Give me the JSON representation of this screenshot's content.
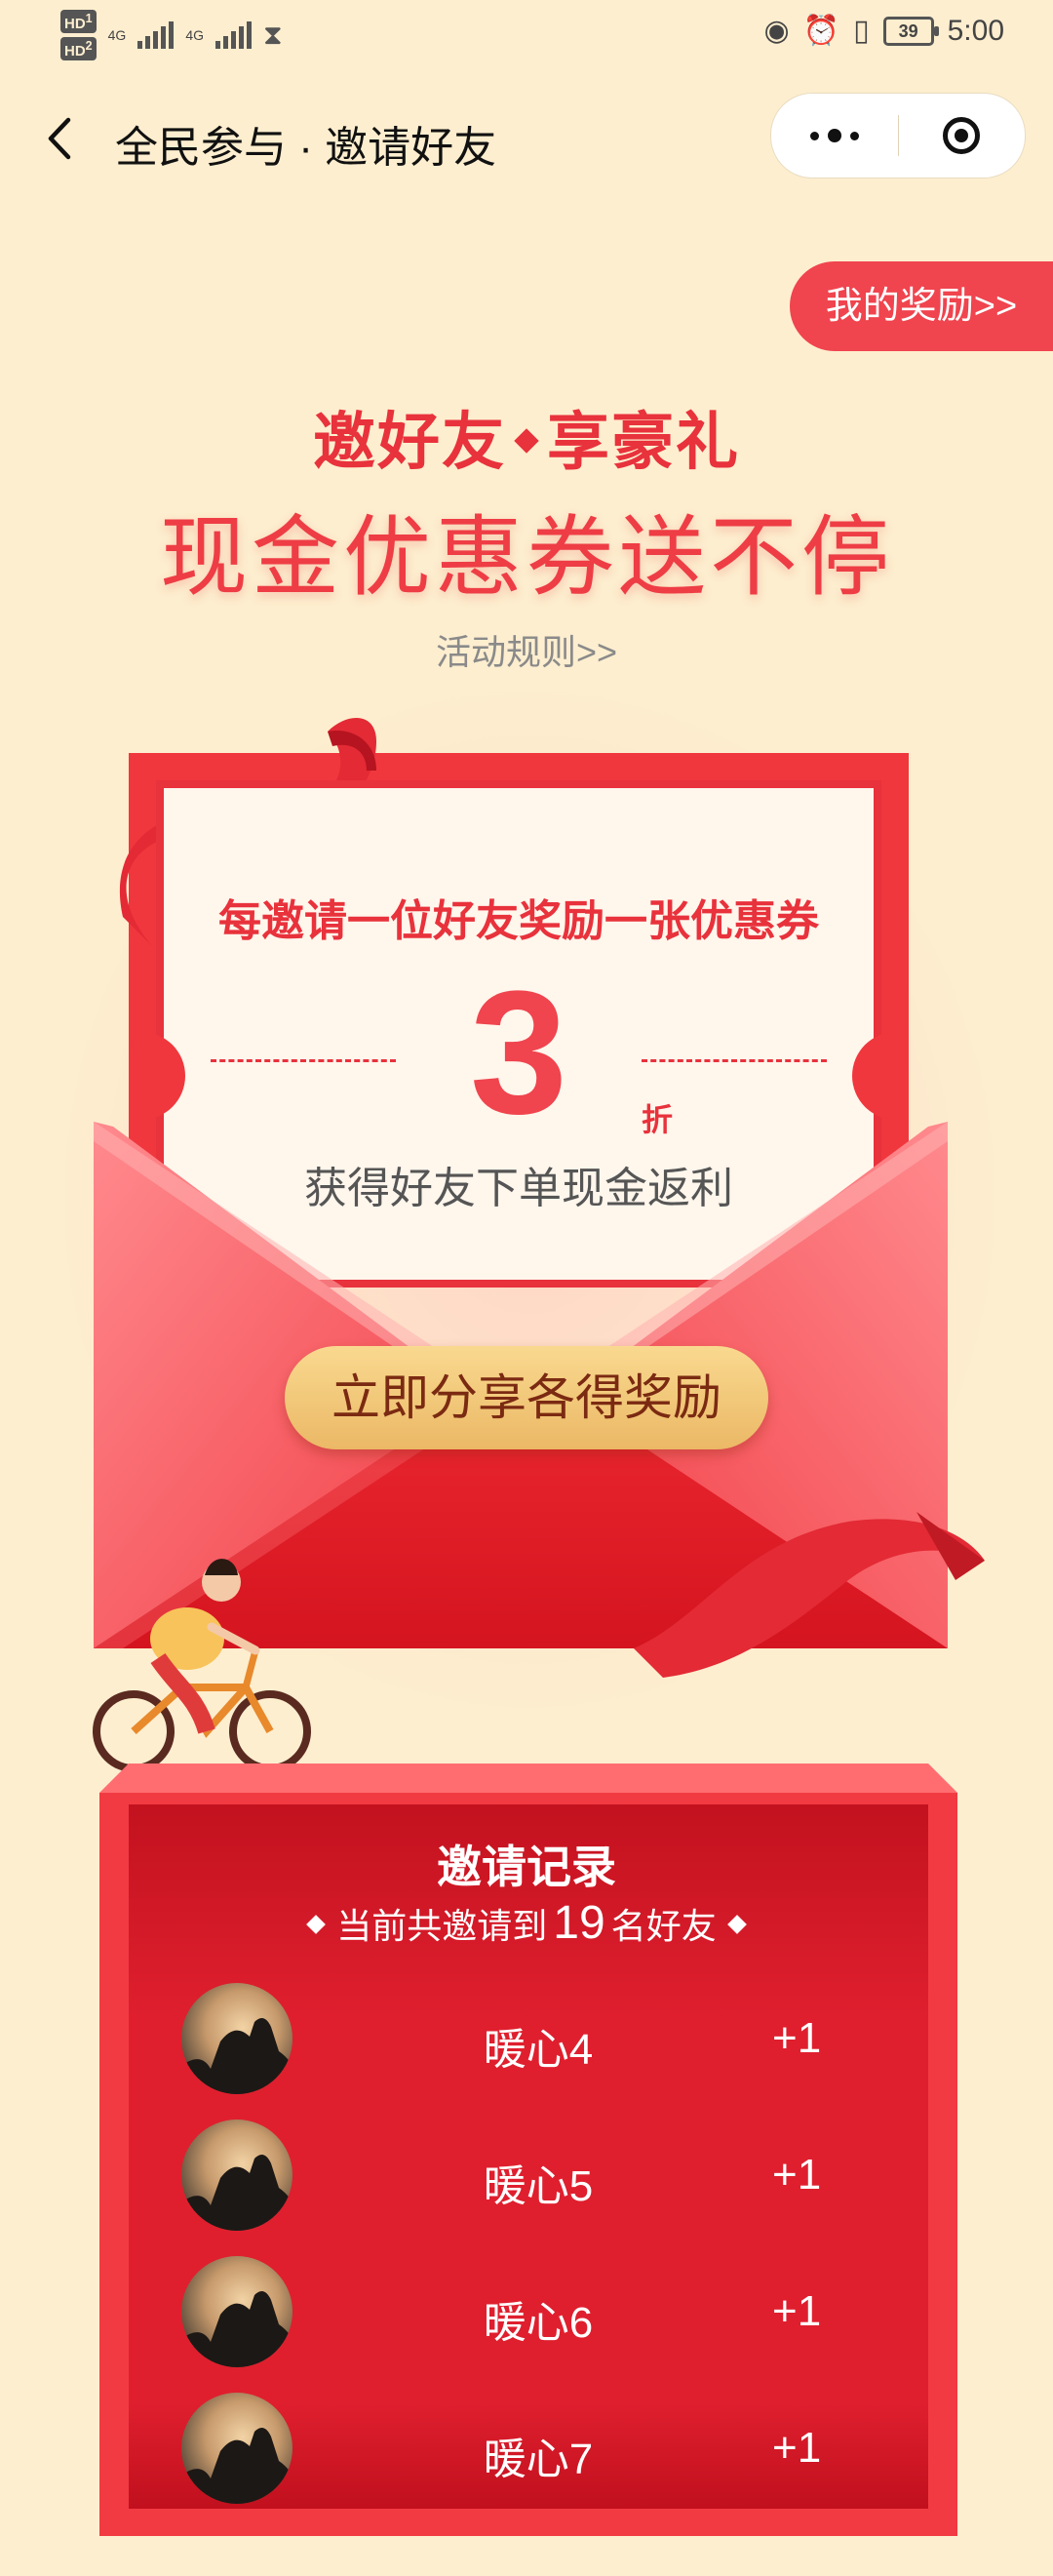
{
  "status_bar": {
    "sim1": "HD",
    "sim2": "HD",
    "sim1_sub": "1",
    "sim2_sub": "2",
    "net1": "4G",
    "net2": "4G",
    "battery": "39",
    "time": "5:00"
  },
  "nav": {
    "title": "全民参与 · 邀请好友"
  },
  "my_reward_label": "我的奖励>>",
  "headline": {
    "line1_a": "邀好友",
    "line1_b": "享豪礼",
    "line2": "现金优惠券送不停"
  },
  "rules_link": "活动规则>>",
  "ticket": {
    "headline": "每邀请一位好友奖励一张优惠券",
    "discount": "3",
    "discount_unit": "折",
    "subtitle": "获得好友下单现金返利"
  },
  "share_button": "立即分享各得奖励",
  "record": {
    "title": "邀请记录",
    "count_prefix": "当前共邀请到",
    "count": "19",
    "count_suffix": "名好友",
    "items": [
      {
        "name": "暖心4",
        "delta": "+1"
      },
      {
        "name": "暖心5",
        "delta": "+1"
      },
      {
        "name": "暖心6",
        "delta": "+1"
      },
      {
        "name": "暖心7",
        "delta": "+1"
      }
    ]
  },
  "colors": {
    "background": "#fdeecf",
    "primary_red": "#e8323c",
    "button_gold": "#f3c979"
  }
}
